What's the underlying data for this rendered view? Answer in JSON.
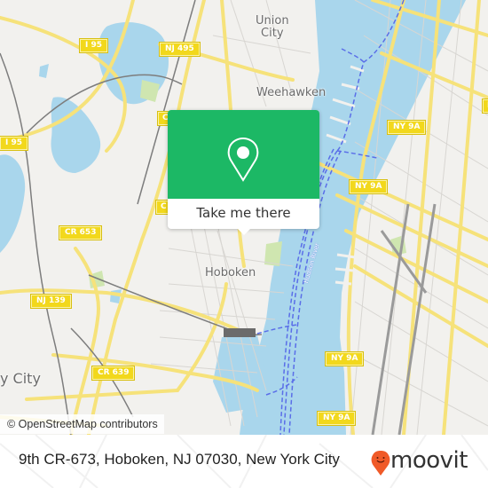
{
  "map": {
    "colors": {
      "land": "#f2f1ee",
      "water": "#a9d6ec",
      "major_road": "#f6e27a",
      "road_outline": "#e8c94a",
      "minor_road": "#d8d6d2",
      "rail": "#7d7d7d",
      "ferry": "#5a6ee8",
      "park": "#cfe6b0",
      "shield": "#f2d81c",
      "popup_green": "#1cb865"
    },
    "place_labels": {
      "union_city": "Union\nCity",
      "weehawken": "Weehawken",
      "hoboken": "Hoboken",
      "jersey_city": "y City"
    },
    "river_label": "Hudson River",
    "road_shields": {
      "i95_top": "I 95",
      "nj495": "NJ 495",
      "i95_left": "I 95",
      "cr_top": "C",
      "cr_mid": "C",
      "cr653": "CR 653",
      "nj139": "NJ 139",
      "cr639": "CR 639",
      "ny9a_1": "NY 9A",
      "ny9a_2": "NY 9A",
      "ny9a_3": "NY 9A",
      "ny9a_4": "NY 9A",
      "edge_right": "E"
    },
    "attribution": "© OpenStreetMap contributors"
  },
  "popup": {
    "icon": "map-pin-icon",
    "button_label": "Take me there"
  },
  "footer": {
    "address": "9th CR-673, Hoboken, NJ 07030, New York City",
    "brand": "moovit",
    "brand_icon": "moovit-smiley-pin-icon",
    "brand_color": "#f05a28"
  }
}
